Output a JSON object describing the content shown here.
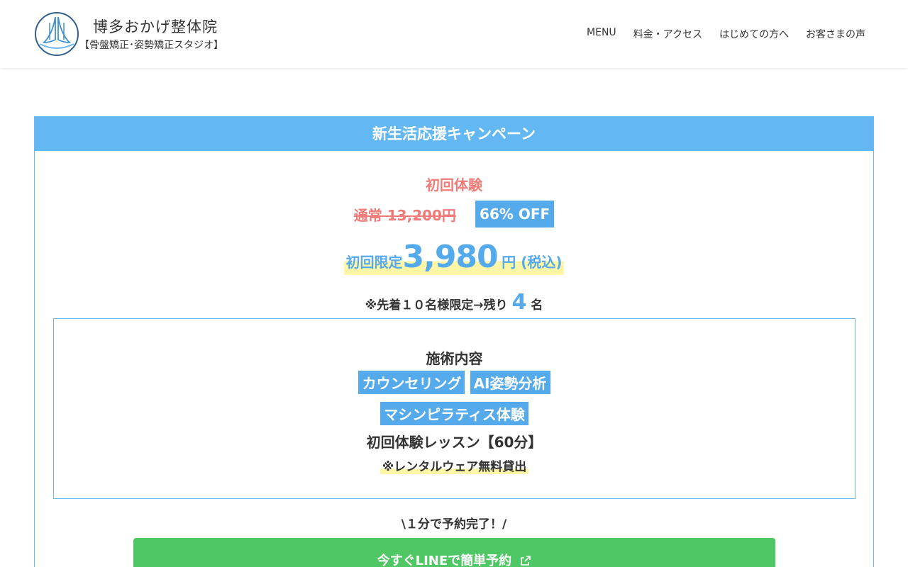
{
  "header": {
    "logo_title": "博多おかげ整体院",
    "logo_subtitle": "【骨盤矯正･姿勢矯正スタジオ】",
    "nav": [
      "MENU",
      "料金・アクセス",
      "はじめての方へ",
      "お客さまの声"
    ]
  },
  "campaign": {
    "heading": "新生活応援キャンペーン",
    "first_trial": "初回体験",
    "normal_price": "通常 13,200円",
    "discount_badge": "66% OFF",
    "limited_label": "初回限定",
    "limited_price": "3,980",
    "limited_unit": "円 (税込)",
    "remain_prefix": "※先着１０名様限定→残り",
    "remain_count": "4",
    "remain_suffix": "名",
    "content": {
      "title": "施術内容",
      "tags_row1": [
        "カウンセリング",
        "AI姿勢分析"
      ],
      "tags_row2": [
        "マシンピラティス体験"
      ],
      "lesson": "初回体験レッスン【60分】",
      "rental_note": "※レンタルウェア無料貸出"
    },
    "quick_text": "\\１分で予約完了！/",
    "line_button": "今すぐLINEで簡単予約"
  },
  "colors": {
    "accent_blue": "#55aaeb",
    "header_blue": "#63b8f3",
    "price_red": "#f07b79",
    "highlight_yellow": "#fdf6a6",
    "line_green": "#4fc764"
  },
  "icons": {
    "logo": "praying-hands-logo-icon",
    "line_button": "external-link-icon"
  }
}
